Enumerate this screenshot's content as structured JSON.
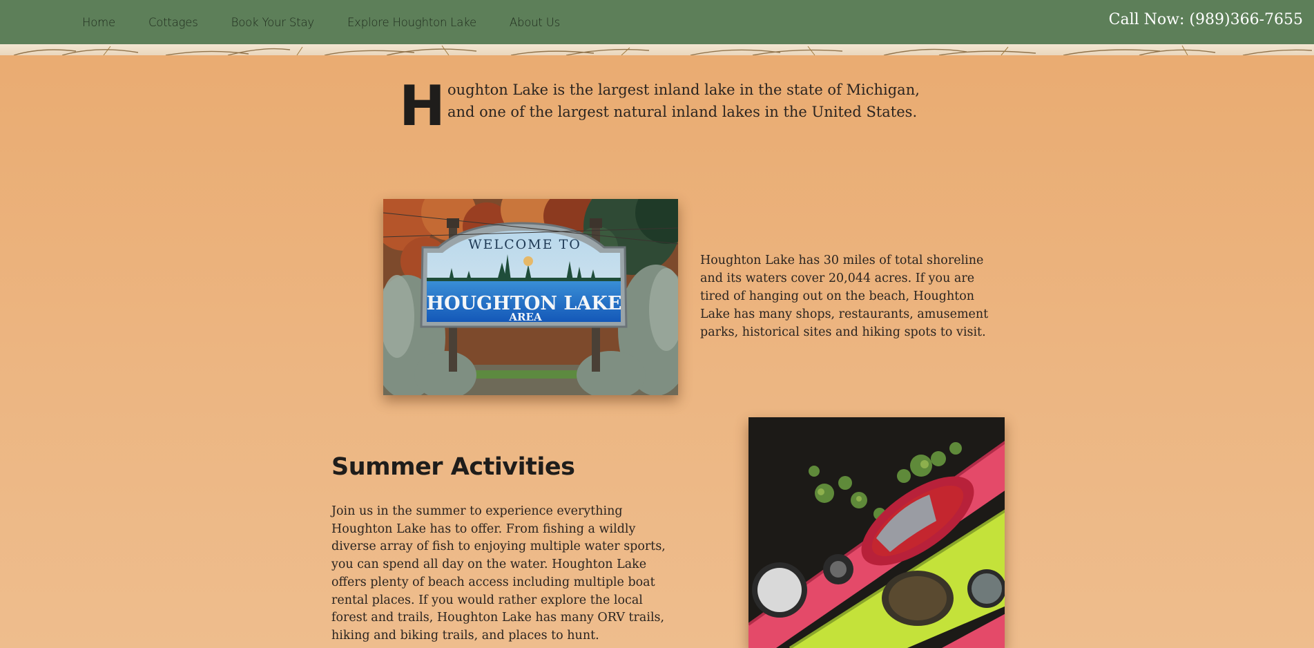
{
  "nav": {
    "items": [
      {
        "label": "Home"
      },
      {
        "label": "Cottages"
      },
      {
        "label": "Book Your Stay"
      },
      {
        "label": "Explore Houghton Lake"
      },
      {
        "label": "About Us"
      }
    ],
    "phone": "Call Now: (989)366-7655"
  },
  "intro": {
    "drop_cap": "H",
    "text": "oughton Lake is the largest inland lake in the state of Michigan, and one of the largest natural inland lakes in the United States."
  },
  "sign_photo": {
    "line1": "WELCOME TO",
    "line2": "HOUGHTON LAKE",
    "line3": "AREA"
  },
  "shoreline": {
    "text": "Houghton Lake has 30 miles of total shoreline and its waters cover 20,044 acres. If you are tired of hanging out on the beach, Houghton Lake has many shops, restaurants, amusement parks, historical sites and hiking spots to visit."
  },
  "summer": {
    "title": "Summer Activities",
    "text": "Join us in the summer to experience everything Houghton Lake has to offer. From fishing a wildly diverse array of fish to enjoying multiple water sports, you can spend all day on the water. Houghton Lake offers plenty of beach access including multiple boat rental places. If you would rather explore the local forest and trails, Houghton Lake has many ORV trails, hiking and biking trails, and places to hunt."
  },
  "colors": {
    "navbar": "#5d7f59",
    "background": "#e9aa6f",
    "phone_text": "#ffffff"
  }
}
